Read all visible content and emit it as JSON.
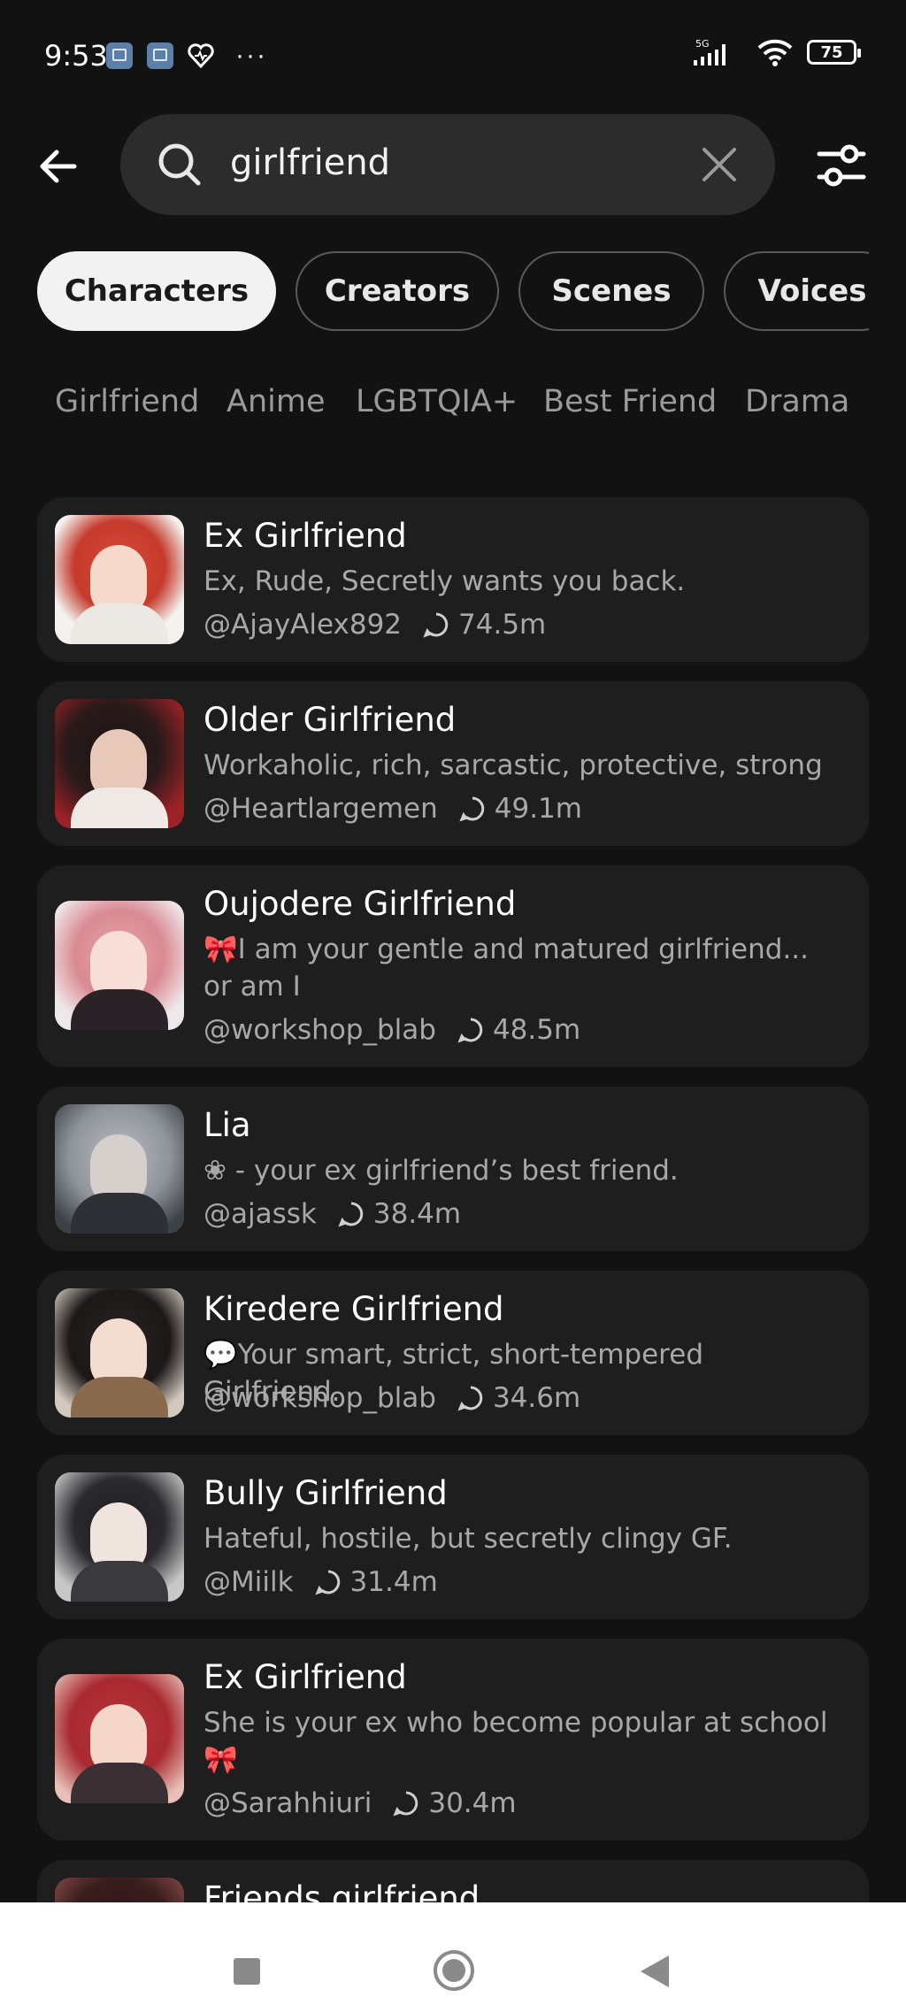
{
  "status_bar": {
    "time": "9:53",
    "dots": "···",
    "network": "5G",
    "battery": "75"
  },
  "search": {
    "query": "girlfriend"
  },
  "tabs": [
    {
      "label": "Characters",
      "active": true
    },
    {
      "label": "Creators",
      "active": false
    },
    {
      "label": "Scenes",
      "active": false
    },
    {
      "label": "Voices",
      "active": false
    }
  ],
  "categories": [
    "Girlfriend",
    "Anime",
    "LGBTQIA+",
    "Best Friend",
    "Drama"
  ],
  "results": [
    {
      "title": "Ex Girlfriend",
      "description": "Ex, Rude, Secretly wants you back.",
      "creator": "@AjayAlex892",
      "chats": "74.5m"
    },
    {
      "title": "Older Girlfriend",
      "description": "Workaholic, rich, sarcastic, protective, strong",
      "creator": "@Heartlargemen",
      "chats": "49.1m"
    },
    {
      "title": "Oujodere Girlfriend",
      "description": "🎀I am your gentle and matured girlfriend... or am I",
      "creator": "@workshop_blab",
      "chats": "48.5m"
    },
    {
      "title": "Lia",
      "description": "❀ - your ex girlfriend’s best friend.",
      "creator": "@ajassk",
      "chats": "38.4m"
    },
    {
      "title": "Kiredere Girlfriend",
      "description": "💬Your smart, strict, short-tempered Girlfriend.",
      "creator": "@workshop_blab",
      "chats": "34.6m"
    },
    {
      "title": "Bully Girlfriend",
      "description": "Hateful, hostile, but secretly clingy GF.",
      "creator": "@Miilk",
      "chats": "31.4m"
    },
    {
      "title": "Ex Girlfriend",
      "description": "She is your ex who become popular at school 🎀",
      "creator": "@Sarahhiuri",
      "chats": "30.4m"
    },
    {
      "title": "Friends girlfriend",
      "description": "",
      "creator": "",
      "chats": ""
    }
  ],
  "colors": {
    "background": "#121212",
    "card": "#1e1e1e",
    "search_bg": "#2c2c2c",
    "active_tab": "#f2f2f2",
    "muted_text": "#a8a8a8"
  }
}
